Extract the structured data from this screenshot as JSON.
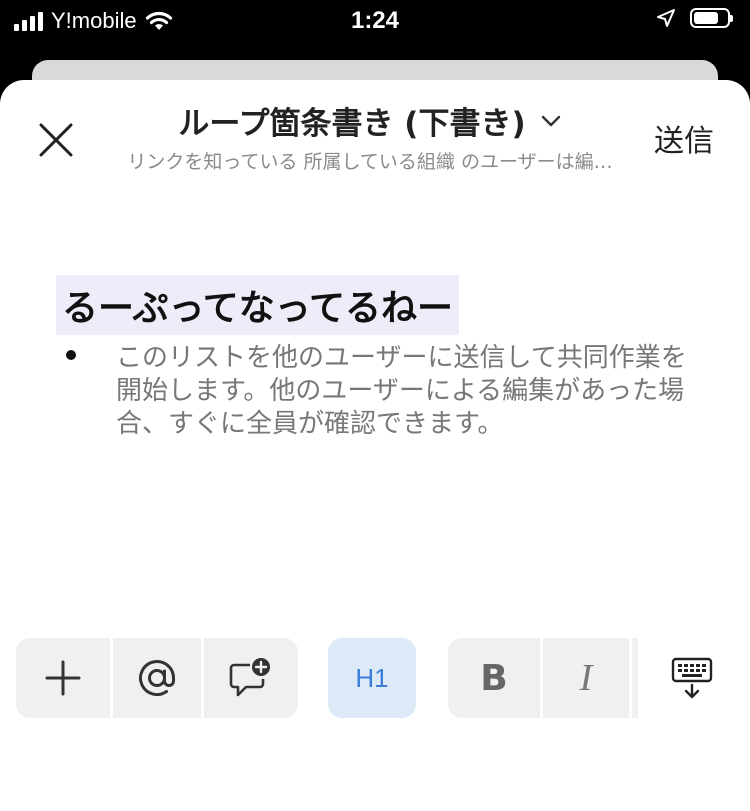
{
  "status_bar": {
    "carrier": "Y!mobile",
    "time": "1:24"
  },
  "header": {
    "title": "ループ箇条書き (下書き)",
    "subtitle": "リンクを知っている 所属している組織 のユーザーは編…",
    "send_label": "送信"
  },
  "document": {
    "heading": "るーぷってなってるねー",
    "bullets": [
      "このリストを他のユーザーに送信して共同作業を開始します。他のユーザーによる編集があった場合、すぐに全員が確認できます。"
    ]
  },
  "toolbar": {
    "h1_label": "H1",
    "bold_label": "B",
    "italic_label": "I"
  },
  "colors": {
    "accent": "#3b7dd8",
    "heading_highlight": "#ecedf8",
    "toolbar_bg": "#f0f0f0"
  }
}
